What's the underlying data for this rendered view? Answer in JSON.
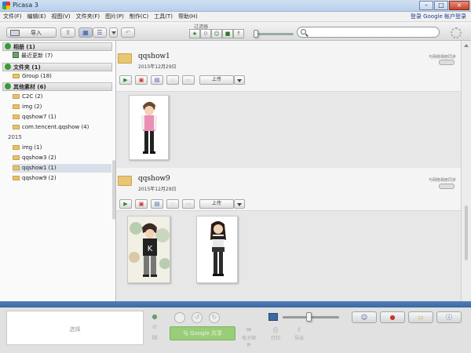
{
  "window": {
    "title": "Picasa 3",
    "minimize": "–",
    "maximize": "□",
    "close": "×"
  },
  "menu": [
    "文件(F)",
    "编辑(E)",
    "视图(V)",
    "文件夹(F)",
    "图片(P)",
    "制作(C)",
    "工具(T)",
    "帮助(H)"
  ],
  "login": "登录 Google 帐户登录",
  "toolbar": {
    "import_label": "导入",
    "filter_label": "过滤器",
    "filter_buttons": [
      "★",
      "0",
      "☺",
      "■",
      "↑"
    ]
  },
  "sidebar": {
    "sections": [
      {
        "label": "相册 (1)"
      },
      {
        "label": "文件夹 (1)"
      },
      {
        "label": "其他素材 (6)"
      }
    ],
    "albums_items": [
      {
        "label": "最近更新 (7)"
      }
    ],
    "folders_items": [
      {
        "label": "Group (18)"
      }
    ],
    "other_items": [
      {
        "label": "C2C (2)"
      },
      {
        "label": "img (2)"
      },
      {
        "label": "qqshow7 (1)"
      },
      {
        "label": "com.tencent.qqshow (4)"
      }
    ],
    "year_label": "2015",
    "year_items": [
      {
        "label": "img (1)"
      },
      {
        "label": "qqshow3 (2)"
      },
      {
        "label": "qqshow1 (1)"
      },
      {
        "label": "qqshow9 (2)"
      }
    ]
  },
  "albums": [
    {
      "title": "qqshow1",
      "date": "2015年12月29日",
      "sync": "与网络相册同步",
      "upload": "上传"
    },
    {
      "title": "qqshow9",
      "date": "2015年12月29日",
      "sync": "与网络相册同步",
      "upload": "上传"
    }
  ],
  "tray": {
    "hold_label": "选择",
    "share_label": "与 Google 共享",
    "actions": [
      {
        "icon": "✉",
        "label": "电子邮件"
      },
      {
        "icon": "⎙",
        "label": "打印"
      },
      {
        "icon": "⇧",
        "label": "导出"
      }
    ],
    "right_buttons": [
      "☺",
      "●",
      "▭",
      "ⓘ"
    ]
  },
  "colors": {
    "accent_blue": "#3b6aa3",
    "share_green": "#9acd7a",
    "folder_yellow": "#e8c774"
  }
}
